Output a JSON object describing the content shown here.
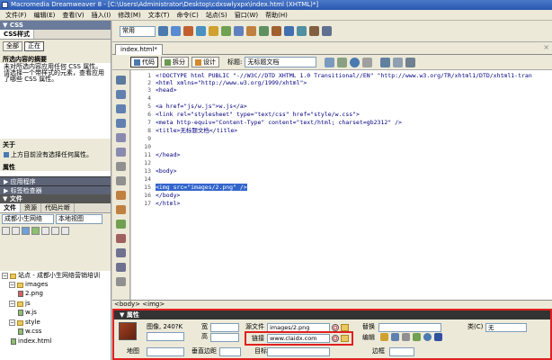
{
  "window": {
    "title": "Macromedia Dreamweaver 8 - [C:\\Users\\Administrator\\Desktop\\cdxswlyxpx\\index.html (XHTML)*]"
  },
  "menu": [
    "文件(F)",
    "编辑(E)",
    "查看(V)",
    "插入(I)",
    "修改(M)",
    "文本(T)",
    "命令(C)",
    "站点(S)",
    "窗口(W)",
    "帮助(H)"
  ],
  "css_panel": {
    "header": "▼ CSS",
    "tab": "CSS样式",
    "btn_all": "全部",
    "btn_current": "正在",
    "summary_title": "所选内容的摘要",
    "summary_text": "未对所选内容应用任何 CSS 属性。请选择一个带样式的元素，查看应用了哪些 CSS 属性。",
    "about_title": "关于",
    "about_text": "上方目前没有选择任何属性。",
    "attributes_title": "属性"
  },
  "collapsed_panels": [
    "▶ 应用程序",
    "▶ 标签检查器"
  ],
  "files_panel": {
    "header": "▼ 文件",
    "tabs": [
      "文件",
      "资源",
      "代码片断"
    ],
    "site_dropdown": "成都小生网络",
    "view_dropdown": "本地视图",
    "tree": [
      {
        "label": "站点 - 成都小生网络营销培训",
        "type": "folder"
      },
      {
        "label": "images",
        "type": "folder"
      },
      {
        "label": "2.png",
        "type": "file"
      },
      {
        "label": "js",
        "type": "folder"
      },
      {
        "label": "w.js",
        "type": "file"
      },
      {
        "label": "style",
        "type": "folder"
      },
      {
        "label": "w.css",
        "type": "file"
      },
      {
        "label": "index.html",
        "type": "file"
      }
    ]
  },
  "toolbar": {
    "category": "常用"
  },
  "document": {
    "tab": "index.html*",
    "view_code": "代码",
    "view_split": "拆分",
    "view_design": "设计",
    "title_label": "标题:",
    "title_value": "无标题文档"
  },
  "code": [
    {
      "n": "1",
      "text": "<!DOCTYPE html PUBLIC \"-//W3C//DTD XHTML 1.0 Transitional//EN\" \"http://www.w3.org/TR/xhtml1/DTD/xhtml1-tran"
    },
    {
      "n": "2",
      "text": "<html xmlns=\"http://www.w3.org/1999/xhtml\">"
    },
    {
      "n": "3",
      "text": "<head>"
    },
    {
      "n": "4",
      "text": ""
    },
    {
      "n": "5",
      "text": "<a href=\"js/w.js\">w.js</a>"
    },
    {
      "n": "6",
      "text": "<link rel=\"stylesheet\" type=\"text/css\" href=\"style/w.css\">"
    },
    {
      "n": "7",
      "text": "<meta http-equiv=\"Content-Type\" content=\"text/html; charset=gb2312\" />"
    },
    {
      "n": "8",
      "text": "<title>无标题文档</title>"
    },
    {
      "n": "9",
      "text": ""
    },
    {
      "n": "10",
      "text": ""
    },
    {
      "n": "11",
      "text": "</head>"
    },
    {
      "n": "12",
      "text": ""
    },
    {
      "n": "13",
      "text": "<body>"
    },
    {
      "n": "14",
      "text": ""
    },
    {
      "n": "15",
      "text": "<img src=\"images/2.png\" />"
    },
    {
      "n": "16",
      "text": "</body>"
    },
    {
      "n": "17",
      "text": "</html>"
    }
  ],
  "tag_selector": "<body> <img>",
  "properties": {
    "header": "▼ 属性",
    "image_label": "图像, 240?K",
    "width_label": "宽",
    "height_label": "高",
    "src_label": "源文件",
    "src_value": "images/2.png",
    "link_label": "链接",
    "link_value": "www.claidx.com",
    "alt_label": "替换",
    "class_label": "类(C)",
    "class_value": "无",
    "edit_label": "编辑",
    "map_label": "地图",
    "vspace_label": "垂直边距",
    "target_label": "目标",
    "border_label": "边框"
  }
}
